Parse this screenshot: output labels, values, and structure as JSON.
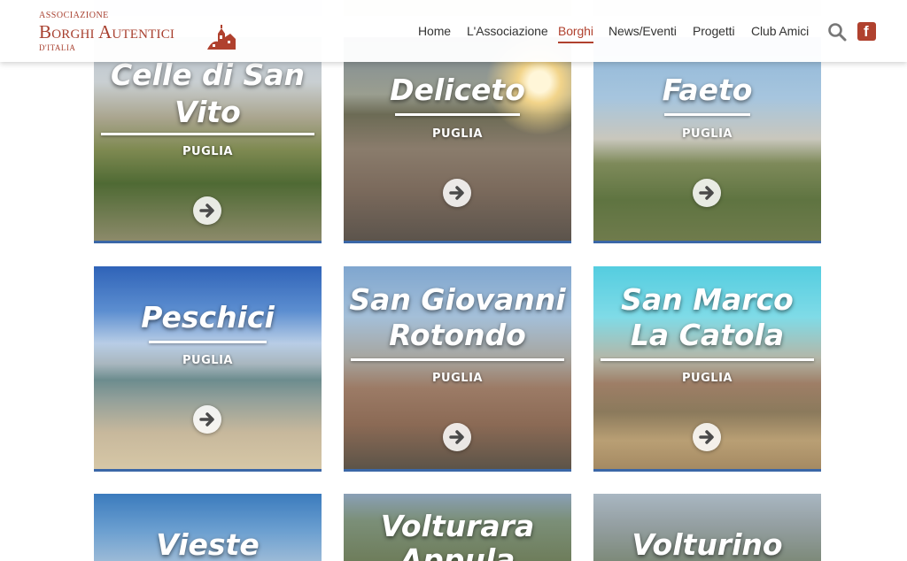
{
  "header": {
    "logo": {
      "top": "ASSOCIAZIONE",
      "main": "Borghi Autentici",
      "bottom": "D'ITALIA",
      "emblem_icon": "village-emblem-icon"
    },
    "nav": [
      {
        "label": "Home",
        "active": false
      },
      {
        "label": "L'Associazione",
        "active": false
      },
      {
        "label": "Borghi",
        "active": true
      },
      {
        "label": "News/Eventi",
        "active": false
      },
      {
        "label": "Progetti",
        "active": false
      },
      {
        "label": "Club Amici",
        "active": false
      }
    ],
    "search_icon": "search-icon",
    "facebook_icon": "facebook-icon"
  },
  "colors": {
    "brand": "#b0412e",
    "card_border": "#3b67a7"
  },
  "cards": [
    {
      "title": "Celle di San Vito",
      "region": "PUGLIA"
    },
    {
      "title": "Deliceto",
      "region": "PUGLIA"
    },
    {
      "title": "Faeto",
      "region": "PUGLIA"
    },
    {
      "title": "Peschici",
      "region": "PUGLIA"
    },
    {
      "title": "San Giovanni Rotondo",
      "region": "PUGLIA"
    },
    {
      "title": "San Marco La Catola",
      "region": "PUGLIA"
    },
    {
      "title": "Vieste",
      "region": ""
    },
    {
      "title": "Volturara Appula",
      "region": ""
    },
    {
      "title": "Volturino",
      "region": ""
    }
  ]
}
